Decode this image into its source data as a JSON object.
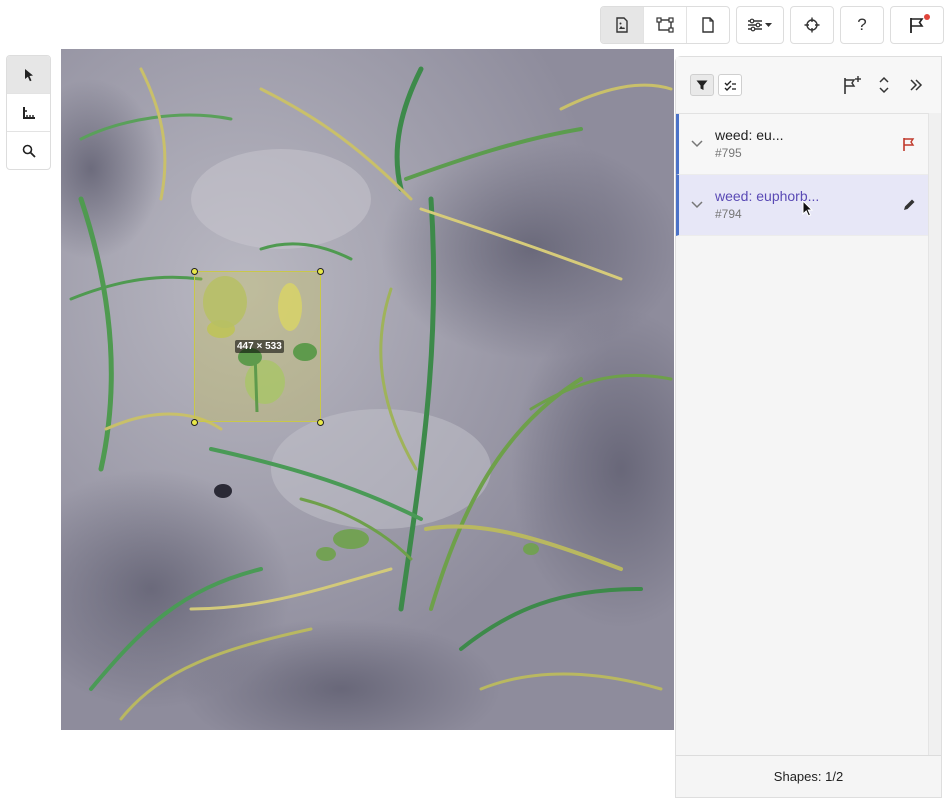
{
  "toolbar": {
    "buttons": [
      {
        "name": "image-view-icon",
        "active": true
      },
      {
        "name": "transform-icon",
        "active": false
      },
      {
        "name": "document-icon",
        "active": false
      },
      {
        "name": "filters-icon",
        "active": false
      },
      {
        "name": "crosshair-icon",
        "active": false
      },
      {
        "name": "help-icon",
        "label": "?"
      },
      {
        "name": "flag-icon",
        "has_notification": true
      }
    ]
  },
  "left_tools": [
    "pointer-icon",
    "ruler-icon",
    "search-icon"
  ],
  "canvas": {
    "bbox_size_label": "447 × 533",
    "bbox_color": "#c9c84a"
  },
  "panel": {
    "header_icons": [
      "filter-icon",
      "check-all-icon",
      "add-flag-icon",
      "expand-collapse-icon",
      "collapse-panel-icon"
    ],
    "items": [
      {
        "label": "weed: eu...",
        "id": "#795",
        "action_icon": "flag-icon",
        "selected": false
      },
      {
        "label": "weed: euphorb...",
        "id": "#794",
        "action_icon": "pencil-icon",
        "selected": true
      }
    ],
    "footer": "Shapes: 1/2"
  },
  "colors": {
    "accent": "#4b72c7",
    "selected_text": "#5a4ab5",
    "flag_red": "#c0392b"
  }
}
